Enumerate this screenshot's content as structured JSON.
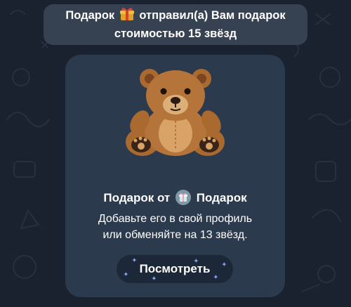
{
  "service_message": {
    "line1_prefix": "Подарок",
    "line1_suffix": "отправил(а) Вам подарок",
    "line2": "стоимостью 15 звёзд",
    "gift_icon": "gift-box-icon"
  },
  "gift_card": {
    "sticker": "teddy-bear-sticker",
    "title_prefix": "Подарок от",
    "sender_name": "Подарок",
    "sender_avatar": "gift-avatar-icon",
    "desc_line1": "Добавьте его в свой профиль",
    "desc_line2": "или обменяйте на 13 звёзд.",
    "button_label": "Посмотреть"
  },
  "colors": {
    "background": "#1a2230",
    "bubble": "#3a4657",
    "card": "#2c3a4e",
    "button": "#1a2534",
    "sparkle": "#8aa6ff"
  }
}
